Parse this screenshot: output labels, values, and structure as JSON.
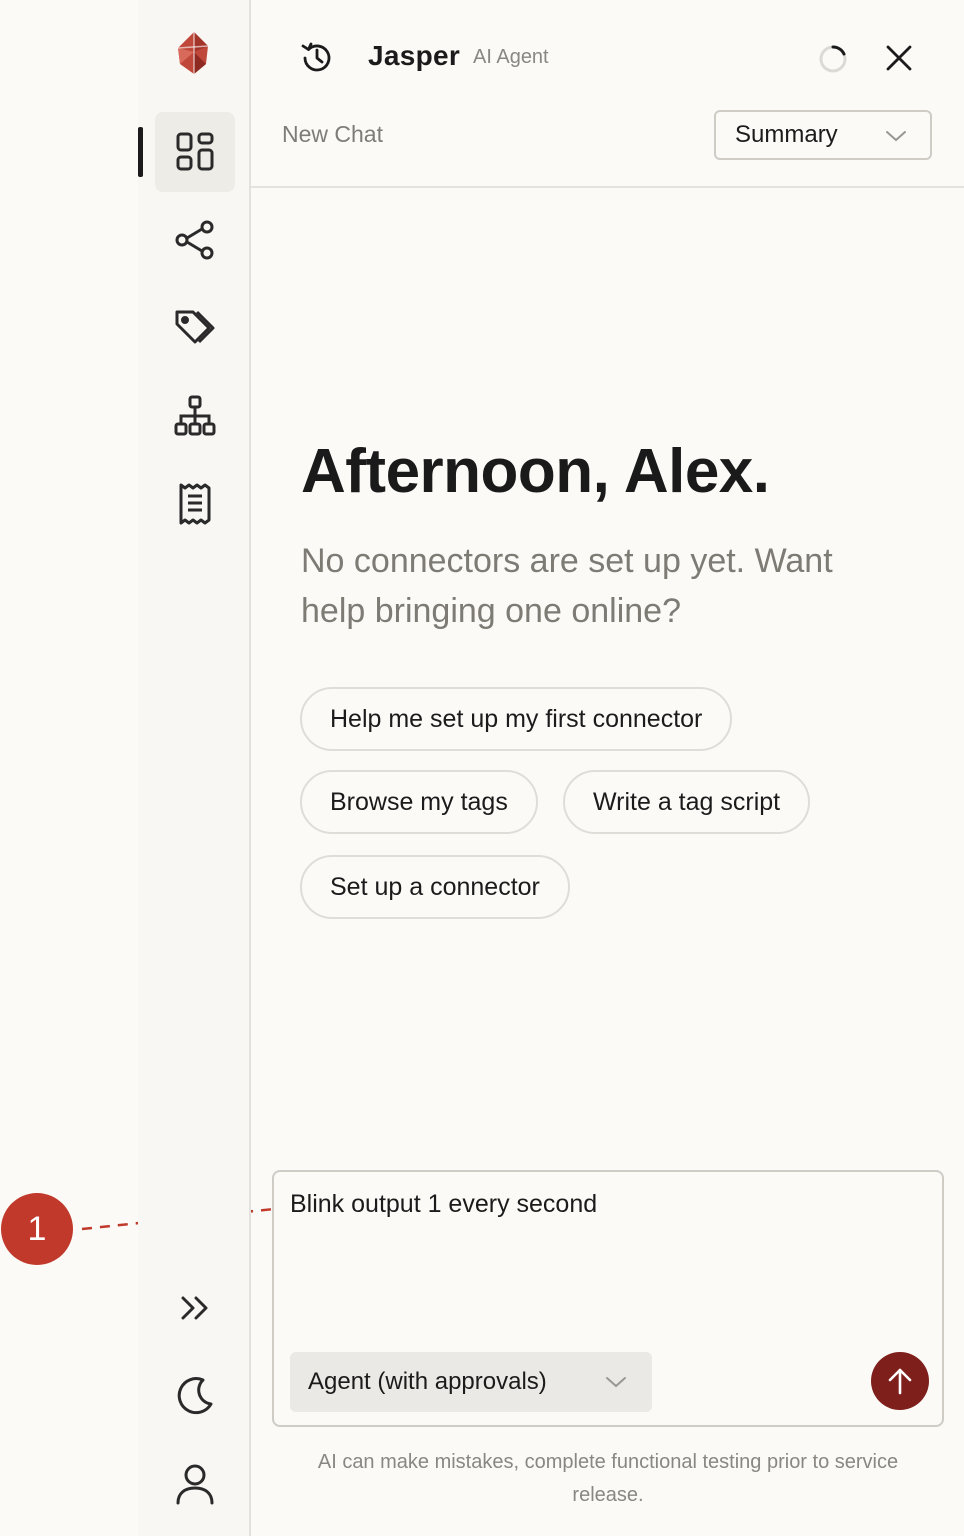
{
  "header": {
    "app_name": "Jasper",
    "app_subtitle": "AI Agent",
    "new_chat_label": "New Chat",
    "mode_value": "Summary"
  },
  "sidebar": {
    "items": [
      {
        "name": "dashboard",
        "icon": "grid-icon",
        "active": true
      },
      {
        "name": "connectors",
        "icon": "share-nodes-icon"
      },
      {
        "name": "tags",
        "icon": "tags-icon"
      },
      {
        "name": "hierarchy",
        "icon": "hierarchy-icon"
      },
      {
        "name": "logs",
        "icon": "receipt-icon"
      }
    ],
    "bottom": [
      {
        "name": "expand",
        "icon": "double-chevron-right-icon"
      },
      {
        "name": "theme",
        "icon": "moon-icon"
      },
      {
        "name": "profile",
        "icon": "user-icon"
      }
    ]
  },
  "main": {
    "greeting": "Afternoon, Alex.",
    "subline": "No connectors are set up yet. Want help bringing one online?",
    "suggestions": [
      "Help me set up my first connector",
      "Browse my tags",
      "Write a tag script",
      "Set up a connector"
    ]
  },
  "composer": {
    "text": "Blink output 1 every second",
    "agent_mode": "Agent (with approvals)"
  },
  "disclaimer": "AI can make mistakes, complete functional testing prior to service release.",
  "annotation": {
    "label": "1",
    "color": "#c0392b"
  },
  "colors": {
    "accent": "#7e1f1c",
    "logo": "#c0483a"
  }
}
